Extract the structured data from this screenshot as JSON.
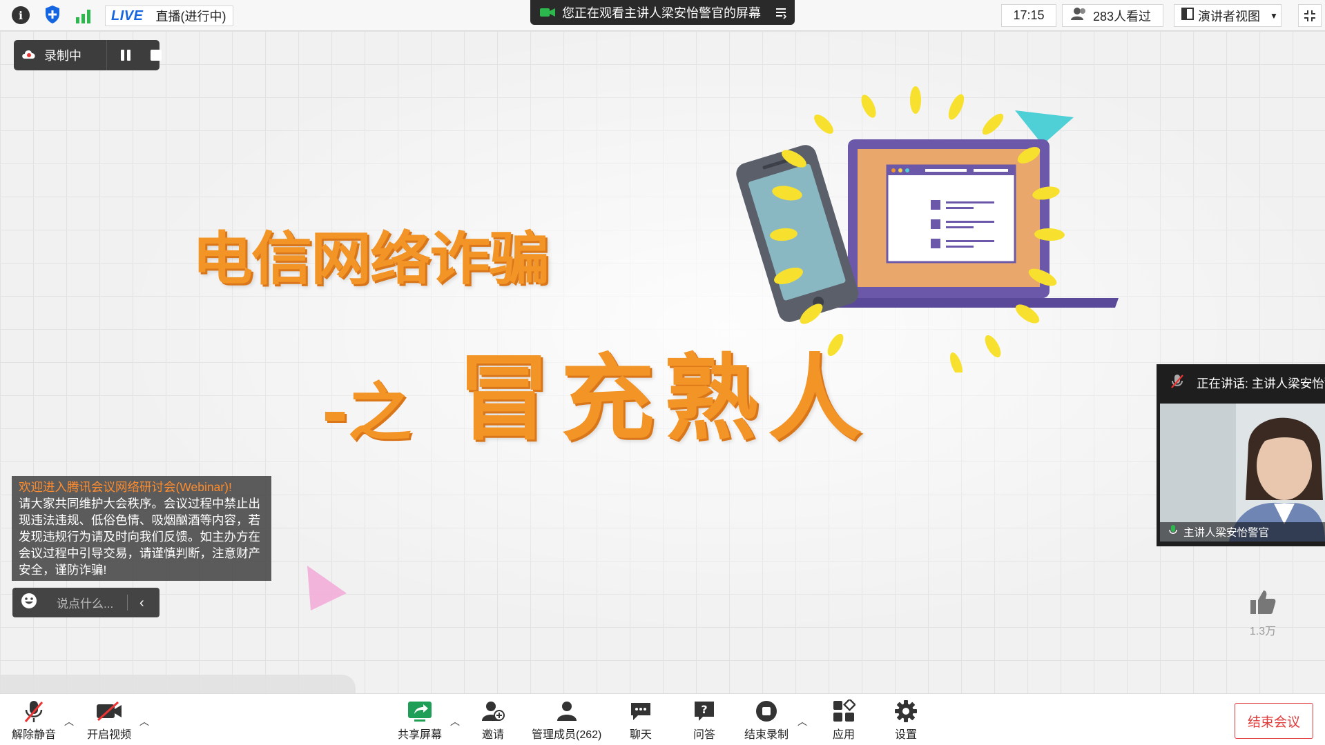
{
  "topbar": {
    "live_badge": "LIVE",
    "live_status": "直播(进行中)",
    "share_banner": "您正在观看主讲人梁安怡警官的屏幕",
    "time": "17:15",
    "viewers": "283人看过",
    "view_mode": "演讲者视图"
  },
  "recording": {
    "label": "录制中"
  },
  "slide": {
    "title_line1": "电信网络诈骗",
    "title_prefix": "-之",
    "title_line2": "冒充熟人"
  },
  "notice": {
    "welcome": "欢迎进入腾讯会议网络研讨会(Webinar)!",
    "body": "请大家共同维护大会秩序。会议过程中禁止出现违法违规、低俗色情、吸烟酗酒等内容，若发现违规行为请及时向我们反馈。如主办方在会议过程中引导交易，请谨慎判断，注意财产安全，谨防诈骗!"
  },
  "chat": {
    "placeholder": "说点什么..."
  },
  "speaker": {
    "speaking_label": "正在讲话: 主讲人梁安怡警官",
    "name": "主讲人梁安怡警官"
  },
  "likes": {
    "count": "1.3万"
  },
  "toolbar": {
    "unmute": "解除静音",
    "start_video": "开启视频",
    "share_screen": "共享屏幕",
    "invite": "邀请",
    "manage_members": "管理成员(262)",
    "chat": "聊天",
    "qa": "问答",
    "end_recording": "结束录制",
    "apps": "应用",
    "settings": "设置",
    "end_meeting": "结束会议"
  },
  "colors": {
    "accent_blue": "#1565e0",
    "title_orange": "#f29426",
    "end_red": "#e03a3a",
    "signal_green": "#2db84d"
  }
}
